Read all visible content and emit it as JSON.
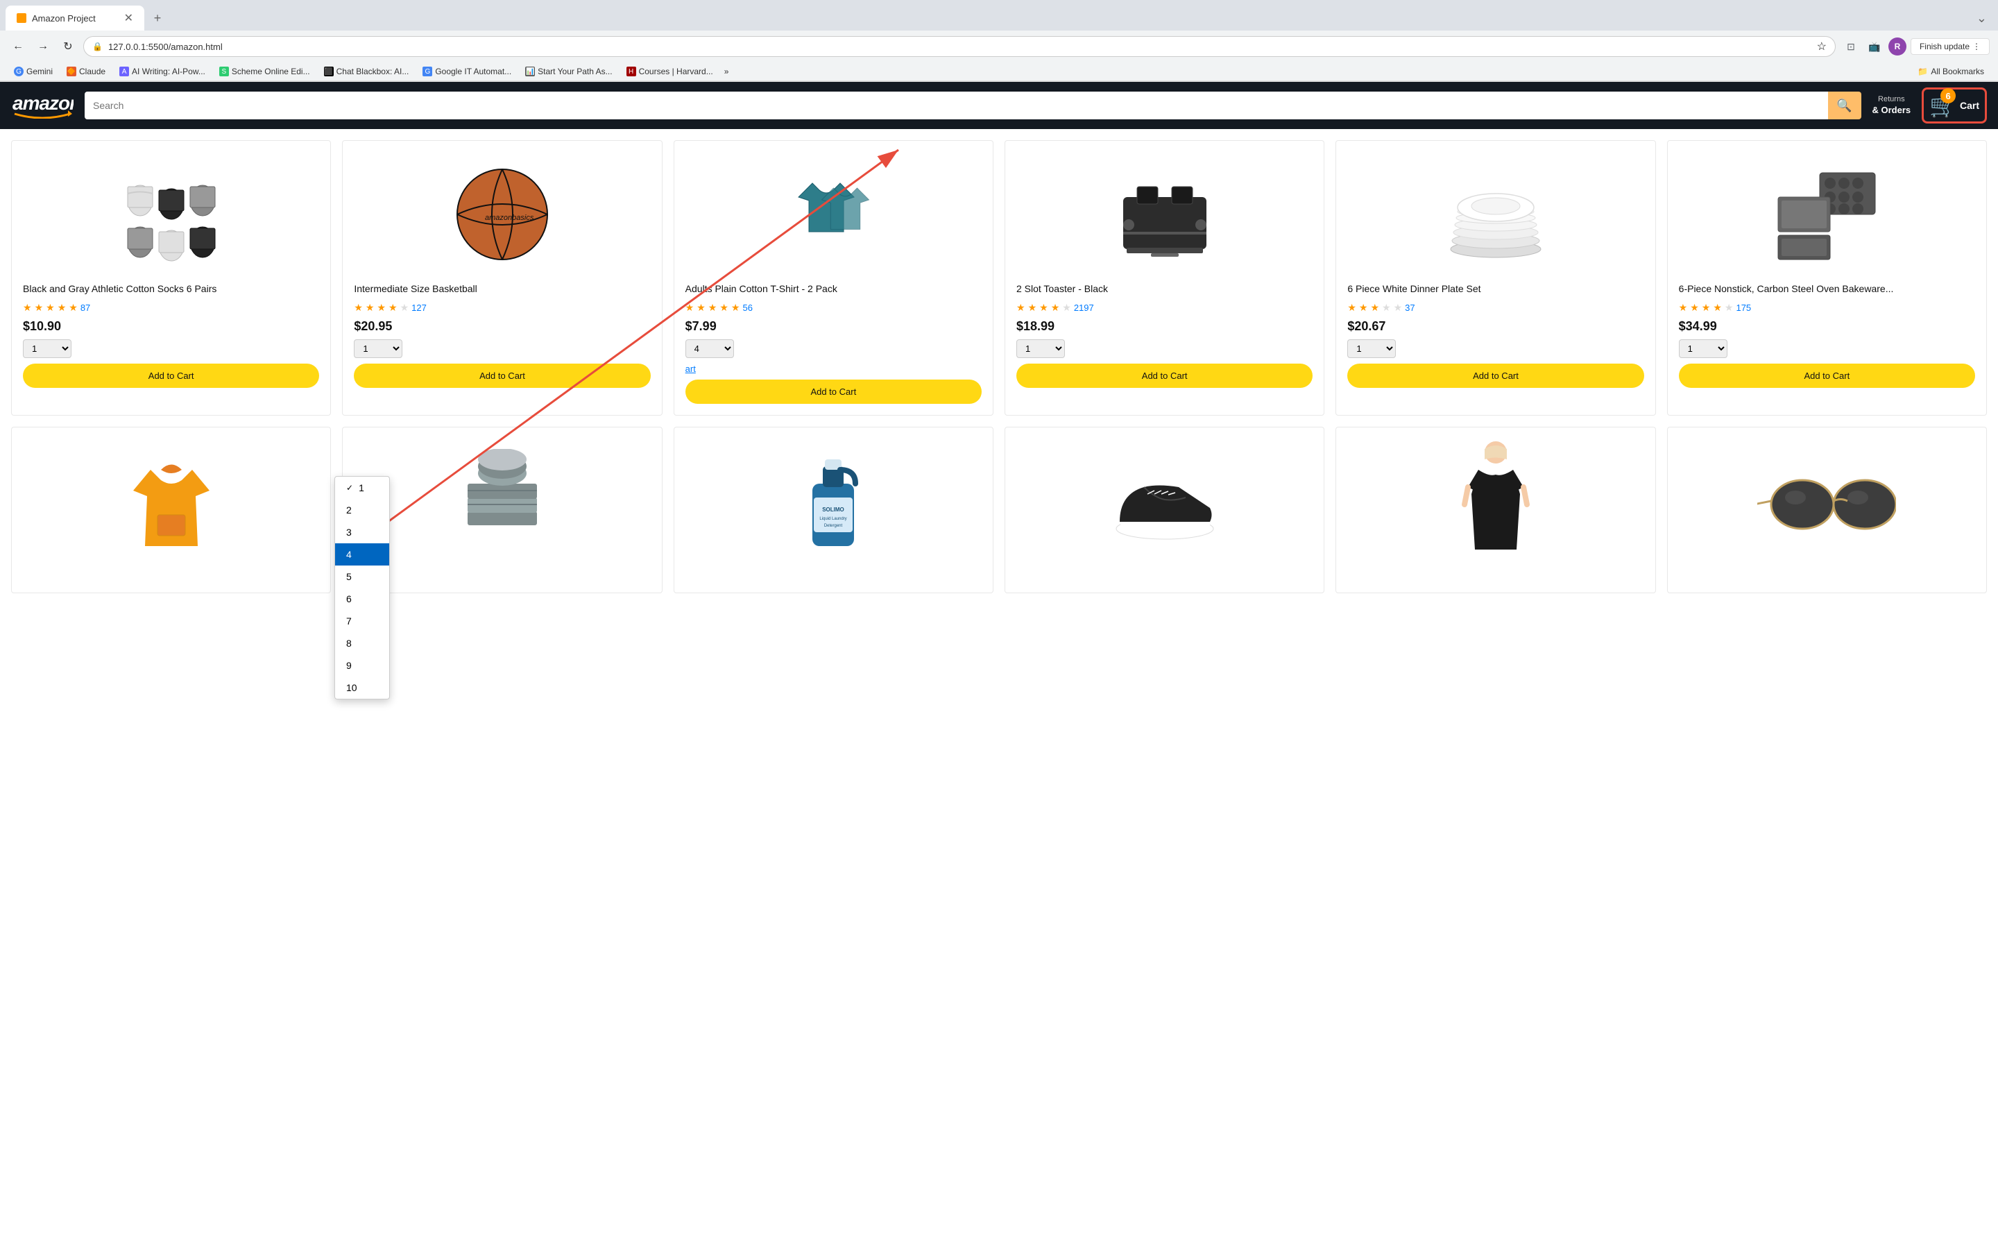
{
  "browser": {
    "tab_title": "Amazon Project",
    "tab_favicon_color": "#ff9900",
    "address": "127.0.0.1:5500/amazon.html",
    "finish_update_label": "Finish update",
    "profile_initial": "R",
    "bookmarks": [
      {
        "label": "Gemini",
        "color": "#4285f4"
      },
      {
        "label": "Claude",
        "color": "#e55a2b"
      },
      {
        "label": "AI Writing: AI-Pow...",
        "color": "#6c63ff"
      },
      {
        "label": "Scheme Online Edi...",
        "color": "#2ecc71"
      },
      {
        "label": "Chat Blackbox: AI...",
        "color": "#000"
      },
      {
        "label": "Google IT Automat...",
        "color": "#4285f4"
      },
      {
        "label": "Start Your Path As...",
        "color": "#555"
      },
      {
        "label": "Courses | Harvard...",
        "color": "#a00000"
      }
    ],
    "all_bookmarks_label": "All Bookmarks"
  },
  "amazon": {
    "logo": "amazon",
    "search_placeholder": "Search",
    "returns_orders": "Returns\n& Orders",
    "cart_count": "6",
    "cart_label": "Cart"
  },
  "products_row1": [
    {
      "title": "Black and Gray Athletic Cotton Socks 6 Pairs",
      "rating": 4.4,
      "review_count": "87",
      "price": "$10.90",
      "quantity": "1",
      "btn_label": "Add to Cart",
      "color": "#888"
    },
    {
      "title": "Intermediate Size Basketball",
      "rating": 4.3,
      "review_count": "127",
      "price": "$20.95",
      "quantity": "1",
      "btn_label": "Add to Cart",
      "color": "#c0622d"
    },
    {
      "title": "Adults Plain Cotton T-Shirt - 2 Pack",
      "rating": 4.4,
      "review_count": "56",
      "price": "$7.99",
      "quantity": "4",
      "btn_label": "Add to Cart",
      "color": "#2e7d8a",
      "already_in_cart": "art",
      "show_dropdown": true
    },
    {
      "title": "2 Slot Toaster - Black",
      "rating": 3.8,
      "review_count": "2197",
      "price": "$18.99",
      "strike_price": "",
      "quantity": "1",
      "btn_label": "Add to Cart",
      "color": "#333"
    },
    {
      "title": "6 Piece White Dinner Plate Set",
      "rating": 3.2,
      "review_count": "37",
      "price": "$20.67",
      "quantity": "1",
      "btn_label": "Add to Cart",
      "color": "#fff"
    },
    {
      "title": "6-Piece Nonstick, Carbon Steel Oven Bakeware...",
      "rating": 4.3,
      "review_count": "175",
      "price": "$34.99",
      "quantity": "1",
      "btn_label": "Add to Cart",
      "color": "#555"
    }
  ],
  "products_row2": [
    {
      "title": "Yellow Hoodie",
      "color": "#f39c12"
    },
    {
      "title": "Gray Towels",
      "color": "#7f8c8d"
    },
    {
      "title": "Liquid Laundry Detergent",
      "color": "#2471a3"
    },
    {
      "title": "Black Sneakers",
      "color": "#222"
    },
    {
      "title": "Black Dress",
      "color": "#1a1a1a"
    },
    {
      "title": "Sunglasses",
      "color": "#222"
    }
  ],
  "dropdown": {
    "items": [
      "1",
      "2",
      "3",
      "4",
      "5",
      "6",
      "7",
      "8",
      "9",
      "10"
    ],
    "selected": "4",
    "checked": "1"
  }
}
